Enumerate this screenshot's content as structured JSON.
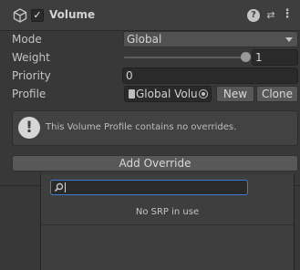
{
  "header": {
    "title": "Volume",
    "enabled_glyph": "✓",
    "help_glyph": "?",
    "preset_glyph": "⇄",
    "more_glyph": "⋮"
  },
  "fields": {
    "mode": {
      "label": "Mode",
      "value": "Global"
    },
    "weight": {
      "label": "Weight",
      "value": "1",
      "slider_fraction": 1.0
    },
    "priority": {
      "label": "Priority",
      "value": "0"
    },
    "profile": {
      "label": "Profile",
      "value": "Global Volu",
      "new_label": "New",
      "clone_label": "Clone"
    }
  },
  "help_box": {
    "icon_glyph": "!",
    "text": "This Volume Profile contains no overrides."
  },
  "add_override_label": "Add Override",
  "popup": {
    "search_value": "",
    "message": "No SRP in use"
  }
}
